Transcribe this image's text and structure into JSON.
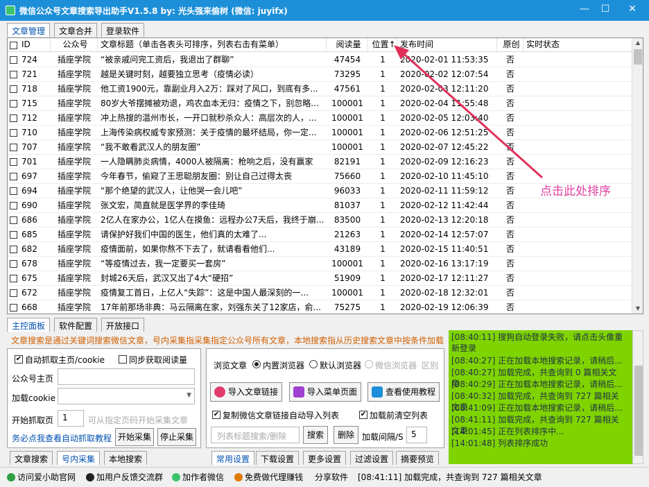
{
  "window": {
    "title": "微信公众号文章搜索导出助手V1.5.8   by: 光头强来偷树   (微信: juyifx)",
    "minimize": "—",
    "maximize": "☐",
    "close": "✕"
  },
  "top_tabs": [
    "文章管理",
    "文章合并",
    "登录软件"
  ],
  "grid": {
    "columns": [
      "ID",
      "公众号",
      "文章标题（单击各表头可排序，列表右击有菜单）",
      "阅读量",
      "位置↑",
      "发布时间",
      "原创",
      "实时状态"
    ],
    "rows": [
      {
        "id": "724",
        "account": "插座学院",
        "title": "“被亲戚问完工资后，我退出了群聊”",
        "reads": "47454",
        "pos": "1",
        "time": "2020-02-01 11:53:35",
        "orig": "否"
      },
      {
        "id": "721",
        "account": "插座学院",
        "title": "越是关键时刻，越要独立思考（疫情必读）",
        "reads": "73295",
        "pos": "1",
        "time": "2020-02-02 12:07:54",
        "orig": "否"
      },
      {
        "id": "718",
        "account": "插座学院",
        "title": "他工资1900元，靠副业月入2万：踩对了风口，到底有多...",
        "reads": "47561",
        "pos": "1",
        "time": "2020-02-03 12:11:20",
        "orig": "否"
      },
      {
        "id": "715",
        "account": "插座学院",
        "title": "80岁大爷摆摊被劝退，鸡农血本无归：疫情之下，别忽略...",
        "reads": "100001",
        "pos": "1",
        "time": "2020-02-04 11:55:48",
        "orig": "否"
      },
      {
        "id": "712",
        "account": "插座学院",
        "title": "冲上热搜的温州市长，一开口就秒杀众人：高层次的人，...",
        "reads": "100001",
        "pos": "1",
        "time": "2020-02-05 12:03:40",
        "orig": "否"
      },
      {
        "id": "710",
        "account": "插座学院",
        "title": "上海传染病权威专家预测：关于疫情的最坏结局，你一定...",
        "reads": "100001",
        "pos": "1",
        "time": "2020-02-06 12:51:25",
        "orig": "否"
      },
      {
        "id": "707",
        "account": "插座学院",
        "title": "“我不敢看武汉人的朋友圈”",
        "reads": "100001",
        "pos": "1",
        "time": "2020-02-07 12:45:22",
        "orig": "否"
      },
      {
        "id": "701",
        "account": "插座学院",
        "title": "一人隐瞒肺炎病情，4000人被隔离：枪响之后，没有赢家",
        "reads": "82191",
        "pos": "1",
        "time": "2020-02-09 12:16:23",
        "orig": "否"
      },
      {
        "id": "697",
        "account": "插座学院",
        "title": "今年春节，偷窥了王思聪朋友圈：别让自己过得太丧",
        "reads": "75660",
        "pos": "1",
        "time": "2020-02-10 11:45:10",
        "orig": "否"
      },
      {
        "id": "694",
        "account": "插座学院",
        "title": "“那个绝望的武汉人，让他哭一会儿吧”",
        "reads": "96033",
        "pos": "1",
        "time": "2020-02-11 11:59:12",
        "orig": "否"
      },
      {
        "id": "690",
        "account": "插座学院",
        "title": "张文宏，简直就是医学界的李佳琦",
        "reads": "81037",
        "pos": "1",
        "time": "2020-02-12 11:42:44",
        "orig": "否"
      },
      {
        "id": "686",
        "account": "插座学院",
        "title": "2亿人在家办公，1亿人在摸鱼：远程办公7天后，我终于崩...",
        "reads": "83500",
        "pos": "1",
        "time": "2020-02-13 12:20:18",
        "orig": "否"
      },
      {
        "id": "685",
        "account": "插座学院",
        "title": "请保护好我们中国的医生，他们真的太难了...",
        "reads": "21263",
        "pos": "1",
        "time": "2020-02-14 12:57:07",
        "orig": "否"
      },
      {
        "id": "682",
        "account": "插座学院",
        "title": "疫情面前，如果你熬不下去了，就请看看他们...",
        "reads": "43189",
        "pos": "1",
        "time": "2020-02-15 11:40:51",
        "orig": "否"
      },
      {
        "id": "678",
        "account": "插座学院",
        "title": "“等疫情过去，我一定要买一套房”",
        "reads": "100001",
        "pos": "1",
        "time": "2020-02-16 13:17:19",
        "orig": "否"
      },
      {
        "id": "675",
        "account": "插座学院",
        "title": "封城26天后，武汉又出了4大“硬招”",
        "reads": "51909",
        "pos": "1",
        "time": "2020-02-17 12:11:27",
        "orig": "否"
      },
      {
        "id": "672",
        "account": "插座学院",
        "title": "疫情复工首日，上亿人“失踪”：这是中国人最深刻的一...",
        "reads": "100001",
        "pos": "1",
        "time": "2020-02-18 12:32:01",
        "orig": "否"
      },
      {
        "id": "668",
        "account": "插座学院",
        "title": "17年前那场非典：马云隔离在家，刘强东关了12家店，俞...",
        "reads": "75275",
        "pos": "1",
        "time": "2020-02-19 12:06:39",
        "orig": "否"
      }
    ]
  },
  "annotation": "点击此处排序",
  "bottom_tabs": [
    "主控面板",
    "软件配置",
    "开放接口"
  ],
  "notice": "文章搜索是通过关键词搜索微信文章，号内采集指采集指定公众号所有文章，本地搜索指从历史搜索文章中按条件加载",
  "left": {
    "auto_crawl": "自动抓取主页/cookie",
    "sync_reads": "同步获取阅读量",
    "homepage_label": "公众号主页",
    "cookie_label": "加载cookie",
    "start_page_label": "开始抓取页",
    "start_page_value": "1",
    "start_page_hint": "可从指定页码开始采集文章",
    "tutorial_link": "务必点我查看自动抓取教程",
    "start_btn": "开始采集",
    "stop_btn": "停止采集",
    "tabs": [
      "文章搜索",
      "号内采集",
      "本地搜索"
    ]
  },
  "middle": {
    "browse_label": "浏览文章",
    "browsers": [
      "内置浏览器",
      "默认浏览器",
      "微信浏览器"
    ],
    "area": "区别",
    "import_link_btn": "导入文章链接",
    "import_menu_btn": "导入菜单页面",
    "tutorial_btn": "查看使用教程",
    "auto_import": "复制微信文章链接自动导入列表",
    "clear_before": "加载前清空列表",
    "search_placeholder": "列表标题搜索/删除",
    "search_btn": "搜索",
    "delete_btn": "删除",
    "interval_label": "加载间隔/S",
    "interval_value": "5",
    "tabs": [
      "常用设置",
      "下载设置",
      "更多设置",
      "过滤设置",
      "摘要预览"
    ]
  },
  "log": [
    "[08:40:11] 搜狗自动登录失败，请点击头像重新登录",
    "[08:40:27] 正在加载本地搜索记录，请稍后...",
    "[08:40:27] 加载完成，共查询到 0 篇相关文章",
    "[08:40:29] 正在加载本地搜索记录，请稍后...",
    "[08:40:32] 加载完成，共查询到 727 篇相关文章",
    "[08:41:09] 正在加载本地搜索记录，请稍后...",
    "[08:41:11] 加载完成，共查询到 727 篇相关文章",
    "[14:01:45] 正在列表排序中...",
    "[14:01:48] 列表排序成功"
  ],
  "status": {
    "official_site": "访问爱小助官网",
    "feedback": "加用户反馈交流群",
    "add_wechat": "加作者微信",
    "agent": "免费做代理赚钱",
    "share": "分享软件",
    "message": "[08:41:11] 加载完成，共查询到 727 篇相关文章"
  },
  "colors": {
    "titlebar": "#1d8fd8",
    "log_bg": "#7fd400",
    "annotation": "#e040a0",
    "notice": "#d06000",
    "link": "#0050b0"
  }
}
